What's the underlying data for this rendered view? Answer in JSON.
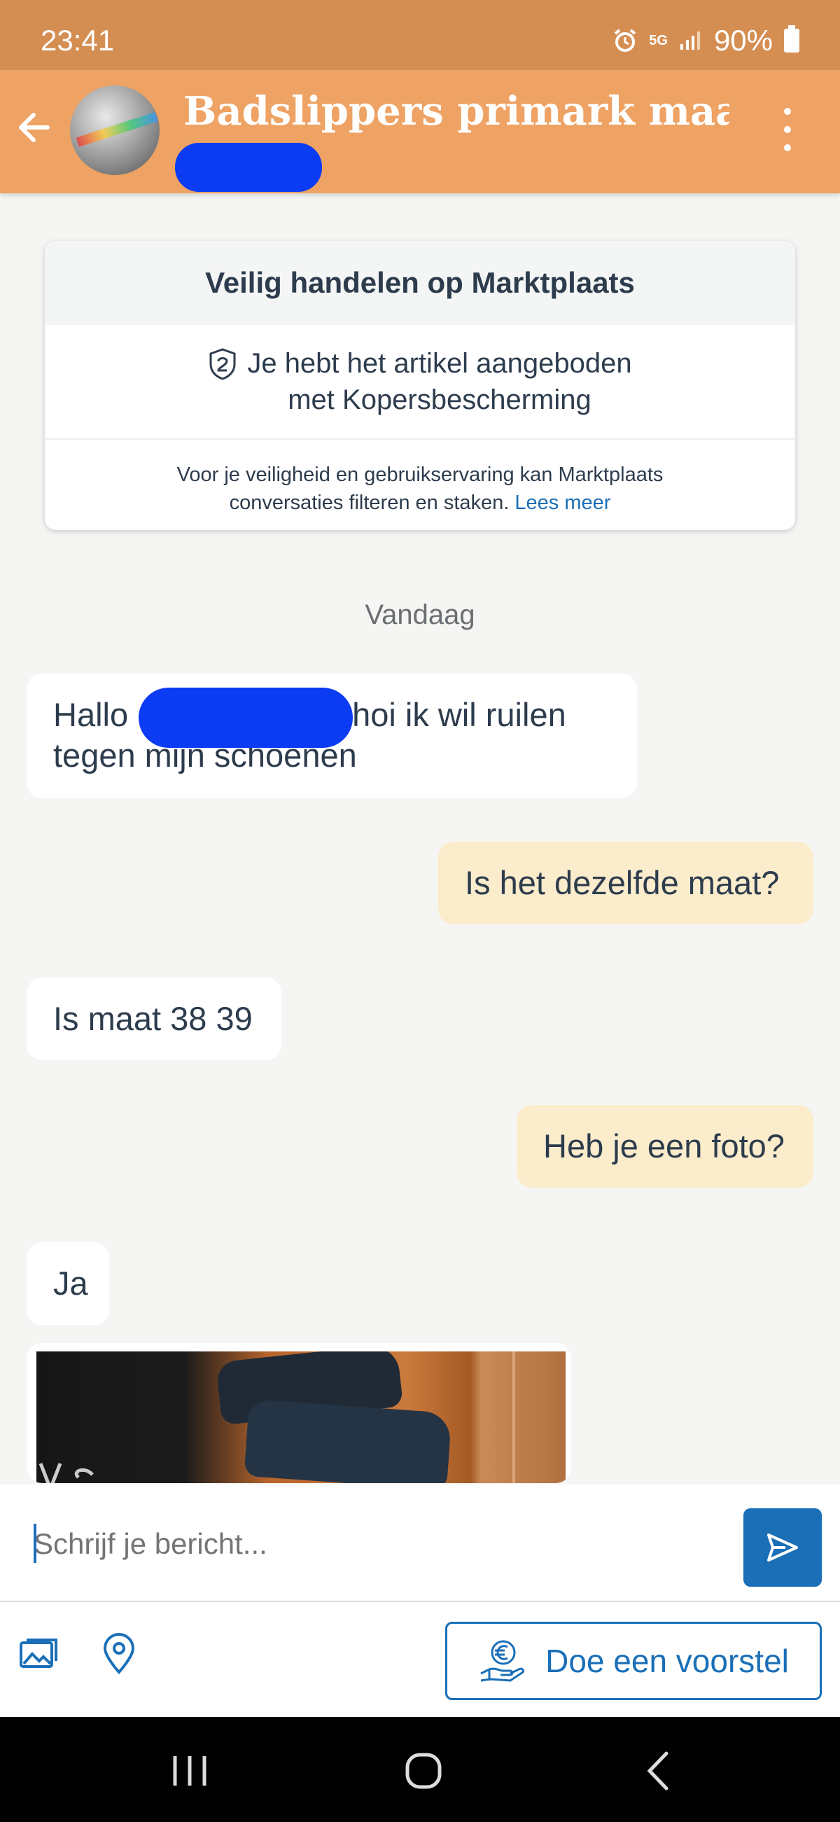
{
  "status_bar": {
    "time": "23:41",
    "network": "5G",
    "battery": "90%"
  },
  "header": {
    "title": "Badslippers primark maa..."
  },
  "safety_card": {
    "title": "Veilig handelen op Marktplaats",
    "protection_line1": "Je hebt het artikel aangeboden",
    "protection_line2": "met Kopersbescherming",
    "notice_line1": "Voor je veiligheid en gebruikservaring kan Marktplaats",
    "notice_line2": "conversaties filteren en staken.",
    "link": "Lees meer"
  },
  "day_label": "Vandaag",
  "messages": [
    {
      "direction": "incoming",
      "line1_start": "Hallo",
      "line1_end": "hoi ik wil ruilen",
      "line2": "tegen mijn schoenen"
    },
    {
      "direction": "outgoing",
      "text": "Is het dezelfde maat?"
    },
    {
      "direction": "incoming",
      "text": "Is maat 38 39"
    },
    {
      "direction": "outgoing",
      "text": "Heb je een foto?"
    },
    {
      "direction": "incoming",
      "text": "Ja"
    }
  ],
  "composer": {
    "placeholder": "Schrijf je bericht..."
  },
  "toolbar": {
    "offer_label": "Doe een voorstel"
  },
  "icons": {
    "back": "arrow-left-icon",
    "more": "more-vertical-icon",
    "shield": "shield-icon",
    "send": "send-icon",
    "gallery": "image-gallery-icon",
    "location": "location-pin-icon",
    "offer": "euro-hand-icon"
  },
  "colors": {
    "status_bar": "#d58e52",
    "header": "#eea263",
    "accent": "#1a6fb7",
    "outgoing_bubble": "#fbeccc",
    "redaction": "#0b3bf3"
  }
}
